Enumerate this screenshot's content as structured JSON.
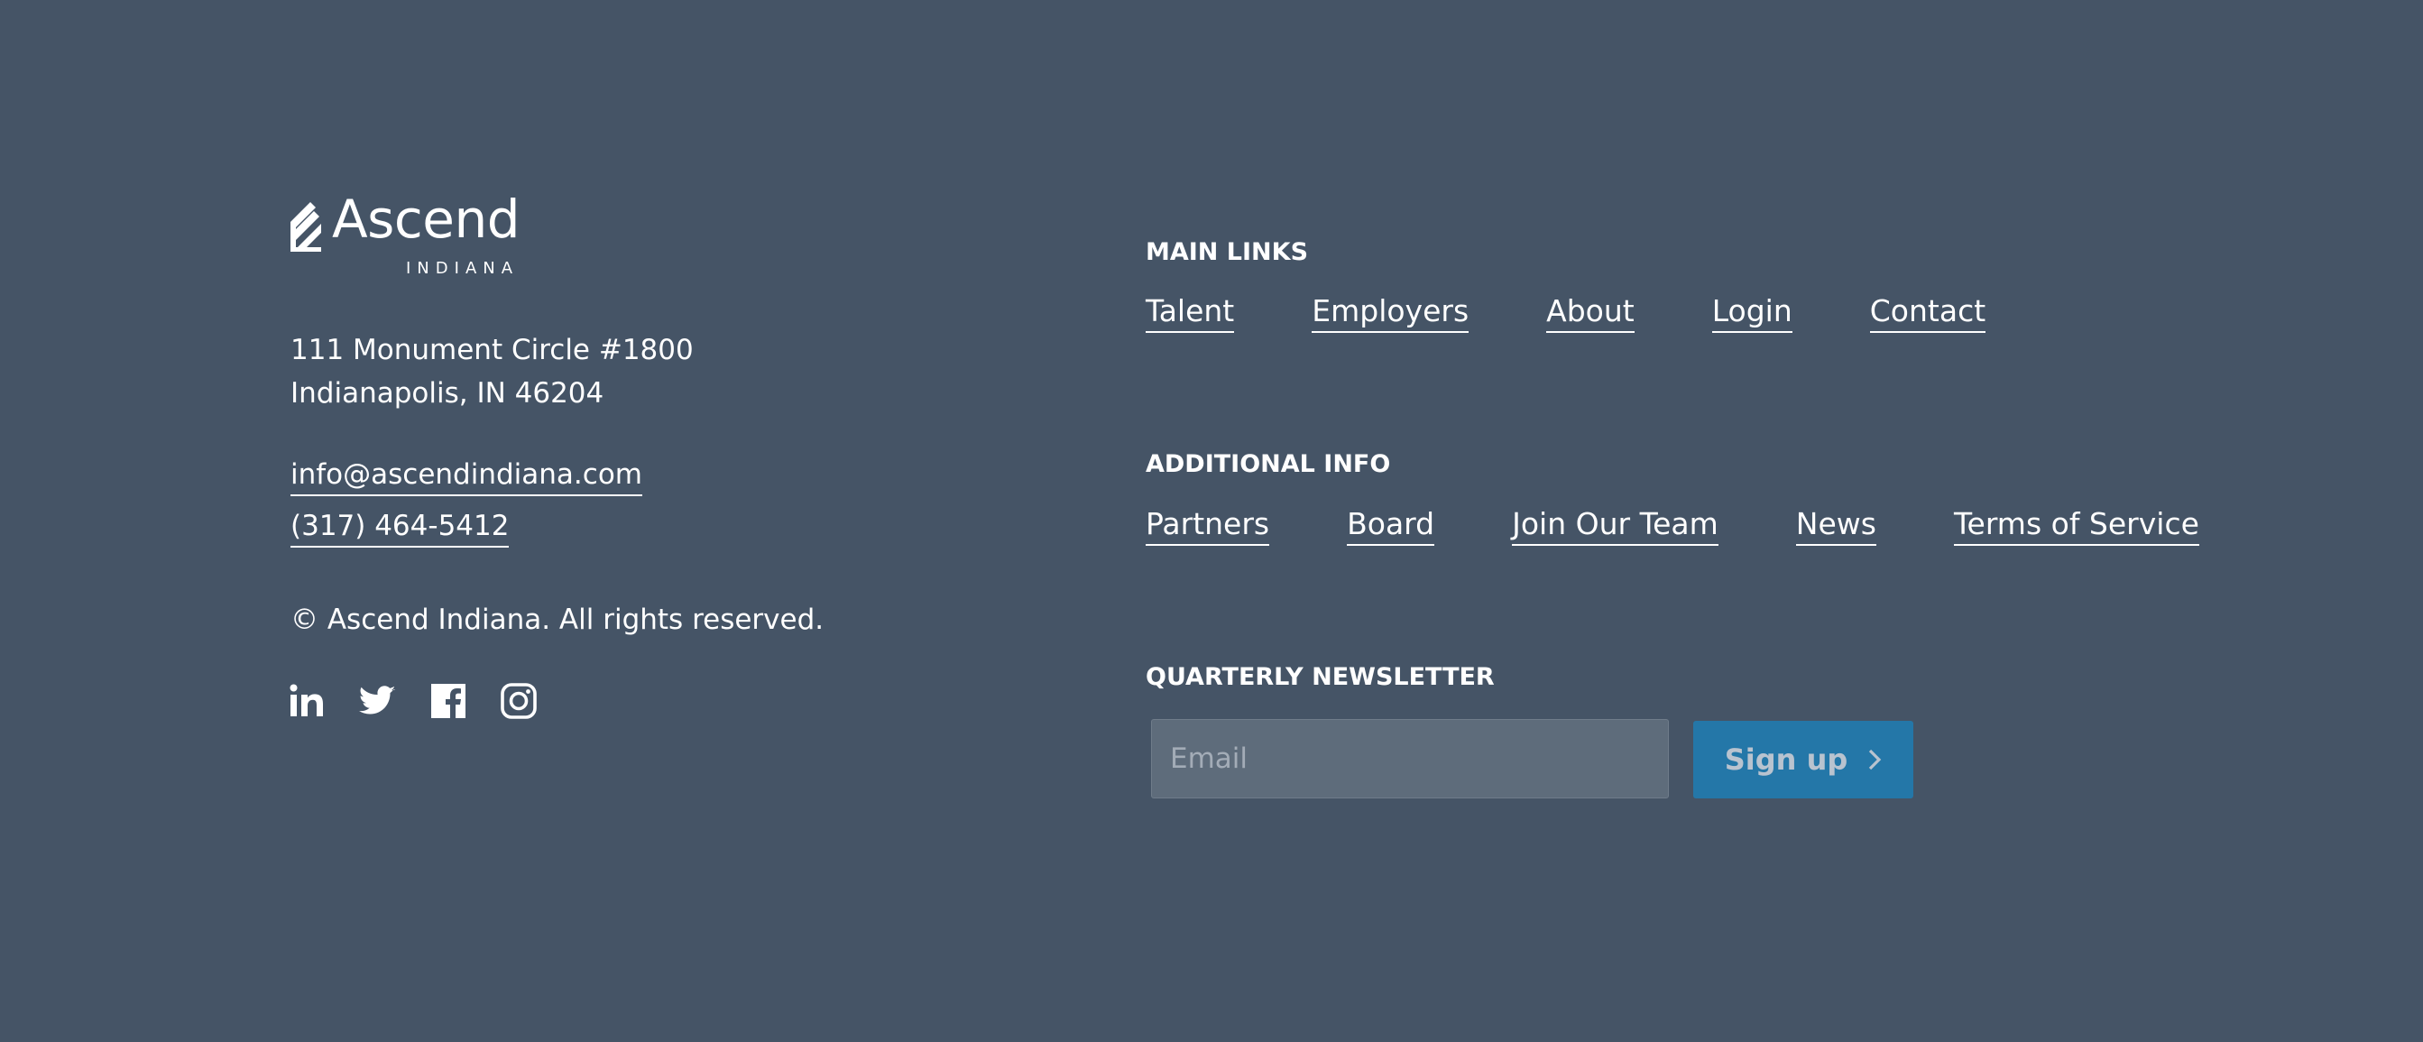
{
  "brand": {
    "name": "Ascend",
    "subname": "INDIANA",
    "logo_icon": "ascend-mark-icon"
  },
  "address": {
    "line1": "111 Monument Circle #1800",
    "line2": "Indianapolis, IN 46204"
  },
  "contact": {
    "email": "info@ascendindiana.com",
    "phone": "(317) 464-5412"
  },
  "copyright": "© Ascend Indiana. All rights reserved.",
  "social": [
    {
      "name": "linkedin-icon"
    },
    {
      "name": "twitter-icon"
    },
    {
      "name": "facebook-icon"
    },
    {
      "name": "instagram-icon"
    }
  ],
  "main_links": {
    "heading": "MAIN LINKS",
    "items": [
      "Talent",
      "Employers",
      "About",
      "Login",
      "Contact"
    ]
  },
  "additional_info": {
    "heading": "ADDITIONAL INFO",
    "items": [
      "Partners",
      "Board",
      "Join Our Team",
      "News",
      "Terms of Service"
    ]
  },
  "newsletter": {
    "heading": "QUARTERLY NEWSLETTER",
    "email_placeholder": "Email",
    "email_value": "",
    "button_label": "Sign up",
    "button_icon": "chevron-right-icon"
  },
  "colors": {
    "background": "#455466",
    "text": "#ffffff",
    "button": "#2477a8",
    "input": "#5e6c7b"
  }
}
